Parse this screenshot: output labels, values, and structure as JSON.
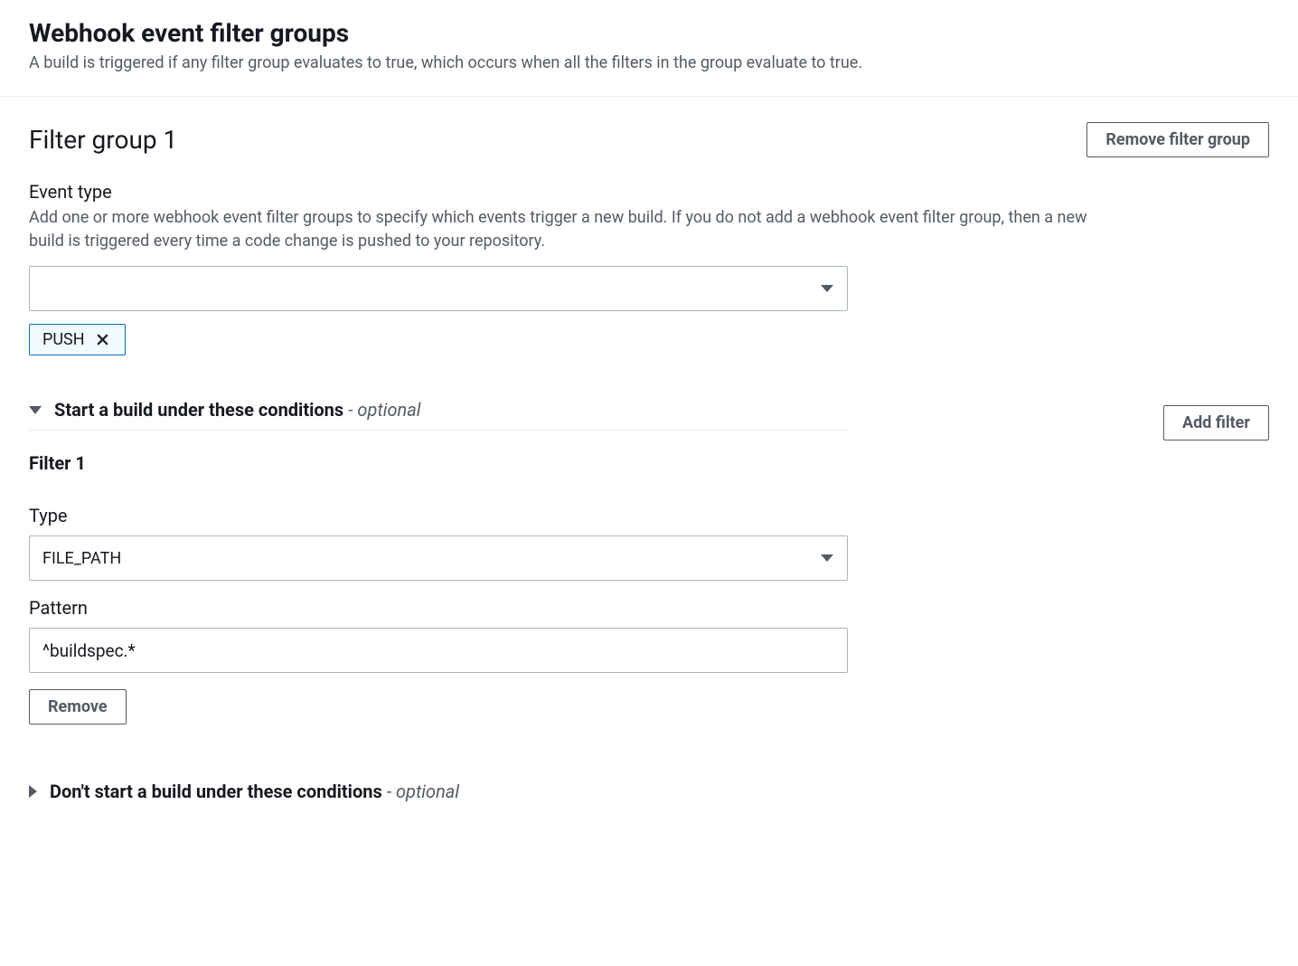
{
  "header": {
    "title": "Webhook event filter groups",
    "subtitle": "A build is triggered if any filter group evaluates to true, which occurs when all the filters in the group evaluate to true."
  },
  "group": {
    "title": "Filter group 1",
    "remove_label": "Remove filter group"
  },
  "event_type": {
    "label": "Event type",
    "description": "Add one or more webhook event filter groups to specify which events trigger a new build. If you do not add a webhook event filter group, then a new build is triggered every time a code change is pushed to your repository.",
    "selected_value": "",
    "tag": "PUSH"
  },
  "start_conditions": {
    "label": "Start a build under these conditions",
    "optional": "- optional",
    "add_filter_label": "Add filter"
  },
  "filter": {
    "title": "Filter 1",
    "type_label": "Type",
    "type_value": "FILE_PATH",
    "pattern_label": "Pattern",
    "pattern_value": "^buildspec.*",
    "remove_label": "Remove"
  },
  "dont_start": {
    "label": "Don't start a build under these conditions",
    "optional": "- optional"
  }
}
